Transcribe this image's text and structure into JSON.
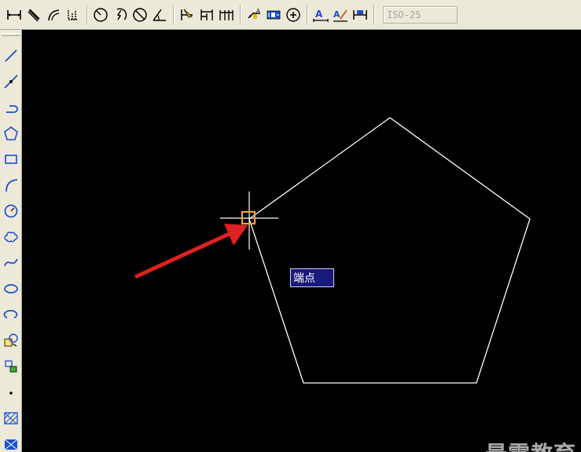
{
  "toolbar": {
    "dimstyle_value": "ISO-25",
    "buttons": [
      {
        "name": "linear-dimension-icon"
      },
      {
        "name": "aligned-dimension-icon"
      },
      {
        "name": "arc-length-icon"
      },
      {
        "name": "ordinate-dimension-icon"
      },
      {
        "name": "radius-dimension-icon"
      },
      {
        "name": "jogged-dimension-icon"
      },
      {
        "name": "diameter-dimension-icon"
      },
      {
        "name": "angular-dimension-icon"
      },
      {
        "name": "quick-dimension-icon"
      },
      {
        "name": "baseline-dimension-icon"
      },
      {
        "name": "continue-dimension-icon"
      },
      {
        "name": "quick-leader-icon"
      },
      {
        "name": "tolerance-icon"
      },
      {
        "name": "center-mark-icon"
      },
      {
        "name": "dimension-edit-icon"
      },
      {
        "name": "dimension-text-edit-icon"
      },
      {
        "name": "dimension-update-icon"
      }
    ]
  },
  "draw_toolbar": {
    "buttons": [
      {
        "name": "line-icon"
      },
      {
        "name": "construction-line-icon"
      },
      {
        "name": "polyline-icon"
      },
      {
        "name": "polygon-icon"
      },
      {
        "name": "rectangle-icon"
      },
      {
        "name": "arc-icon"
      },
      {
        "name": "circle-icon"
      },
      {
        "name": "revision-cloud-icon"
      },
      {
        "name": "spline-icon"
      },
      {
        "name": "ellipse-icon"
      },
      {
        "name": "ellipse-arc-icon"
      },
      {
        "name": "insert-block-icon"
      },
      {
        "name": "make-block-icon"
      },
      {
        "name": "point-icon"
      },
      {
        "name": "hatch-icon"
      },
      {
        "name": "gradient-icon"
      }
    ]
  },
  "canvas": {
    "snap_tooltip": "端点",
    "watermark": "最需教育",
    "colors": {
      "background": "#000000",
      "geometry": "#ffffff",
      "snap_marker": "#f0a040",
      "arrow": "#e02020",
      "tooltip_bg": "#1a1a7a"
    }
  }
}
